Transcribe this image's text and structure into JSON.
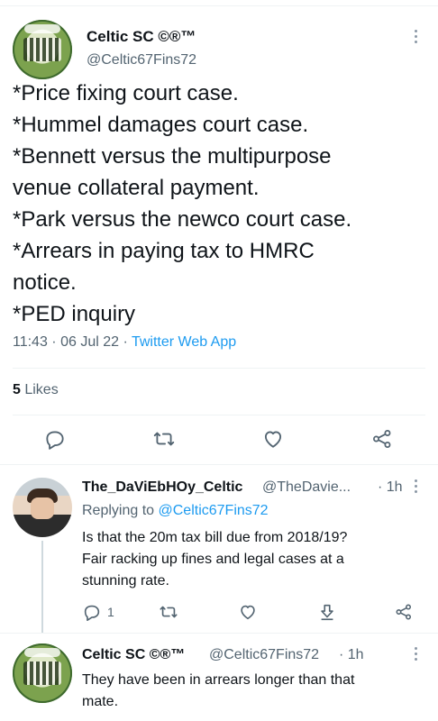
{
  "main_tweet": {
    "display_name": "Celtic SC ©®™",
    "handle": "@Celtic67Fins72",
    "lines": [
      "*Price fixing court case.",
      "*Hummel damages court case.",
      "*Bennett versus the multipurpose",
      "venue collateral payment.",
      "*Park versus the newco court case.",
      "*Arrears in paying tax to HMRC",
      "notice.",
      "*PED inquiry"
    ],
    "time": "11:43 · 06 Jul 22 · ",
    "app": "Twitter Web App",
    "likes_count": "5",
    "likes_label": " Likes"
  },
  "replies": [
    {
      "display_name": "The_DaViEbHOy_Celtic",
      "handle": "@TheDavie...",
      "age": "· 1h",
      "replying_prefix": "Replying to ",
      "replying_to": "@Celtic67Fins72",
      "lines": [
        "Is that the 20m tax bill due from 2018/19?",
        "Fair racking up fines and legal cases at a",
        "stunning rate."
      ],
      "reply_count": "1"
    },
    {
      "display_name": "Celtic SC ©®™",
      "handle": "@Celtic67Fins72",
      "age": "· 1h",
      "lines": [
        "They have been in arrears longer than that",
        "mate."
      ]
    }
  ],
  "colors": {
    "text": "#0f1419",
    "secondary": "#536471",
    "link": "#1d9bf0",
    "divider": "#eff3f4"
  },
  "icons": [
    "reply-icon",
    "retweet-icon",
    "like-icon",
    "share-icon",
    "download-icon",
    "more-icon"
  ]
}
